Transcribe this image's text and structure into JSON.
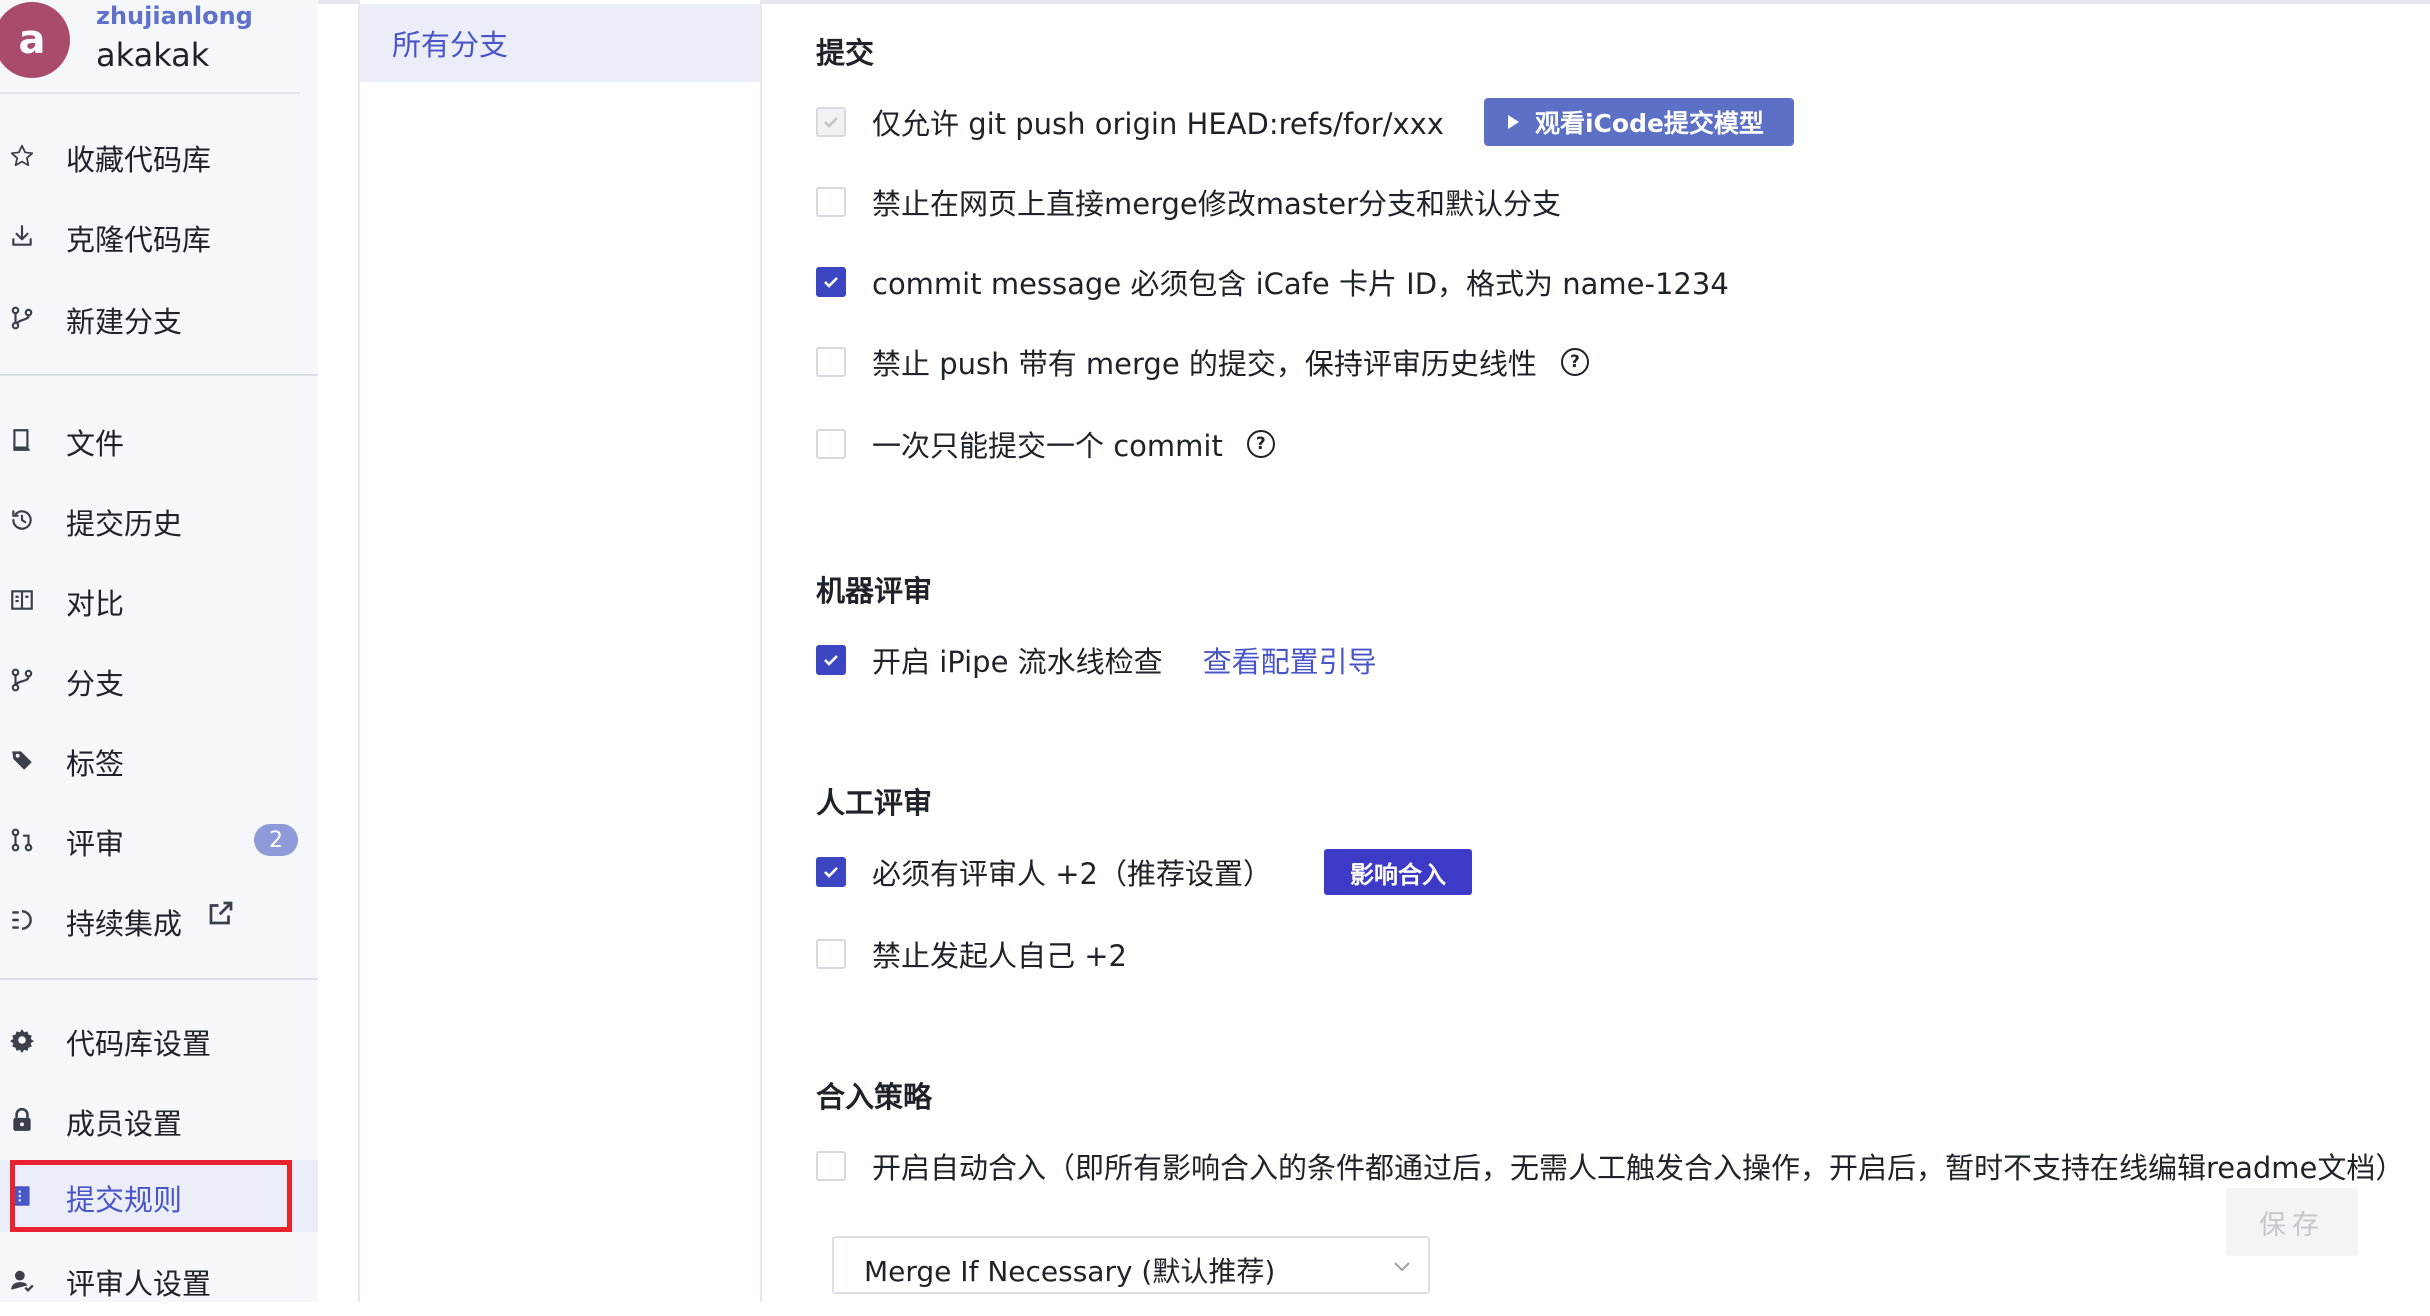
{
  "user": {
    "avatar_letter": "a",
    "login": "zhujianlong",
    "name": "akakak"
  },
  "sidebar": {
    "group1": [
      {
        "label": "收藏代码库",
        "icon": "star-icon"
      },
      {
        "label": "克隆代码库",
        "icon": "download-icon"
      },
      {
        "label": "新建分支",
        "icon": "branch-create-icon"
      }
    ],
    "group2": [
      {
        "label": "文件",
        "icon": "book-icon"
      },
      {
        "label": "提交历史",
        "icon": "history-icon"
      },
      {
        "label": "对比",
        "icon": "compare-icon"
      },
      {
        "label": "分支",
        "icon": "branch-icon"
      },
      {
        "label": "标签",
        "icon": "tag-icon"
      },
      {
        "label": "评审",
        "icon": "pull-request-icon",
        "badge": "2"
      },
      {
        "label": "持续集成",
        "icon": "ci-icon"
      }
    ],
    "group3": [
      {
        "label": "代码库设置",
        "icon": "gear-icon"
      },
      {
        "label": "成员设置",
        "icon": "lock-icon"
      },
      {
        "label": "提交规则",
        "icon": "rules-icon",
        "active": true
      },
      {
        "label": "评审人设置",
        "icon": "reviewer-icon"
      }
    ]
  },
  "branches": {
    "selected": "所有分支"
  },
  "sections": {
    "commit": {
      "title": "提交",
      "options": [
        {
          "text": "仅允许 git push origin HEAD:refs/for/xxx",
          "state": "disabled"
        },
        {
          "text": "禁止在网页上直接merge修改master分支和默认分支",
          "state": "unchecked"
        },
        {
          "text": "commit message 必须包含 iCafe 卡片 ID，格式为 name-1234",
          "state": "checked"
        },
        {
          "text": "禁止 push 带有 merge 的提交，保持评审历史线性",
          "state": "unchecked"
        },
        {
          "text": "一次只能提交一个 commit",
          "state": "unchecked"
        }
      ],
      "model_button": "观看iCode提交模型",
      "help_glyph": "?"
    },
    "machine_review": {
      "title": "机器评审",
      "option": "开启 iPipe 流水线检查",
      "link": "查看配置引导"
    },
    "manual_review": {
      "title": "人工评审",
      "options": [
        {
          "text": "必须有评审人 +2（推荐设置）",
          "state": "checked"
        },
        {
          "text": "禁止发起人自己 +2",
          "state": "unchecked"
        }
      ],
      "impact_tag": "影响合入"
    },
    "merge_strategy": {
      "title": "合入策略",
      "option": "开启自动合入（即所有影响合入的条件都通过后，无需人工触发合入操作，开启后，暂时不支持在线编辑readme文档）",
      "select_value": "Merge If Necessary (默认推荐)"
    }
  },
  "save_label": "保存",
  "colors": {
    "accent": "#3d46c2",
    "highlight": "#e8232f",
    "button": "#5c70c6"
  }
}
